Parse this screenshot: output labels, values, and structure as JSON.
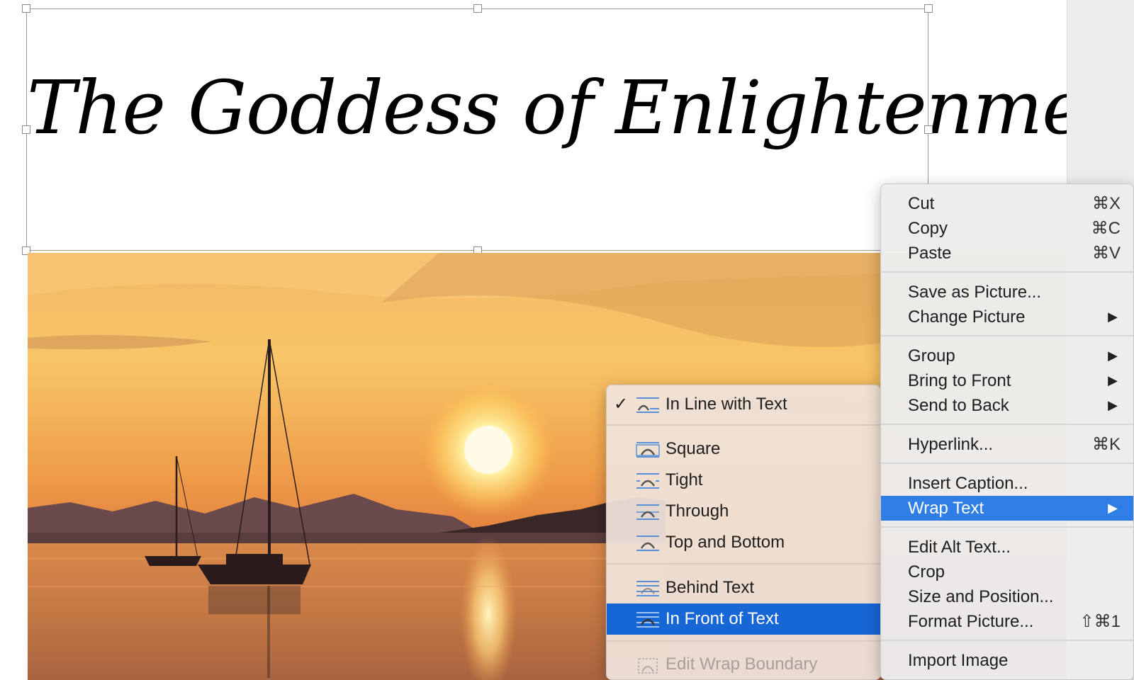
{
  "document": {
    "title_text": "The Goddess of Enlightenment"
  },
  "context_menu": {
    "items": [
      {
        "label": "Cut",
        "shortcut": "⌘X"
      },
      {
        "label": "Copy",
        "shortcut": "⌘C"
      },
      {
        "label": "Paste",
        "shortcut": "⌘V"
      },
      {
        "label": "Save as Picture..."
      },
      {
        "label": "Change Picture",
        "submenu": true
      },
      {
        "label": "Group",
        "submenu": true
      },
      {
        "label": "Bring to Front",
        "submenu": true
      },
      {
        "label": "Send to Back",
        "submenu": true
      },
      {
        "label": "Hyperlink...",
        "shortcut": "⌘K"
      },
      {
        "label": "Insert Caption..."
      },
      {
        "label": "Wrap Text",
        "submenu": true,
        "highlighted": true
      },
      {
        "label": "Edit Alt Text..."
      },
      {
        "label": "Crop"
      },
      {
        "label": "Size and Position..."
      },
      {
        "label": "Format Picture...",
        "shortcut": "⇧⌘1"
      },
      {
        "label": "Import Image"
      }
    ],
    "submenu_arrow": "▶"
  },
  "wrap_text_menu": {
    "items": [
      {
        "label": "In Line with Text",
        "checked": true,
        "check_mark": "✓",
        "icon": "wrap-inline-icon"
      },
      {
        "label": "Square",
        "icon": "wrap-square-icon"
      },
      {
        "label": "Tight",
        "icon": "wrap-tight-icon"
      },
      {
        "label": "Through",
        "icon": "wrap-through-icon"
      },
      {
        "label": "Top and Bottom",
        "icon": "wrap-top-bottom-icon"
      },
      {
        "label": "Behind Text",
        "icon": "wrap-behind-icon"
      },
      {
        "label": "In Front of Text",
        "icon": "wrap-in-front-icon",
        "highlighted": true
      },
      {
        "label": "Edit Wrap Boundary",
        "icon": "edit-wrap-boundary-icon",
        "disabled": true
      }
    ]
  },
  "colors": {
    "menu_highlight": "#2f7ee6",
    "submenu_highlight": "#1766d6"
  }
}
